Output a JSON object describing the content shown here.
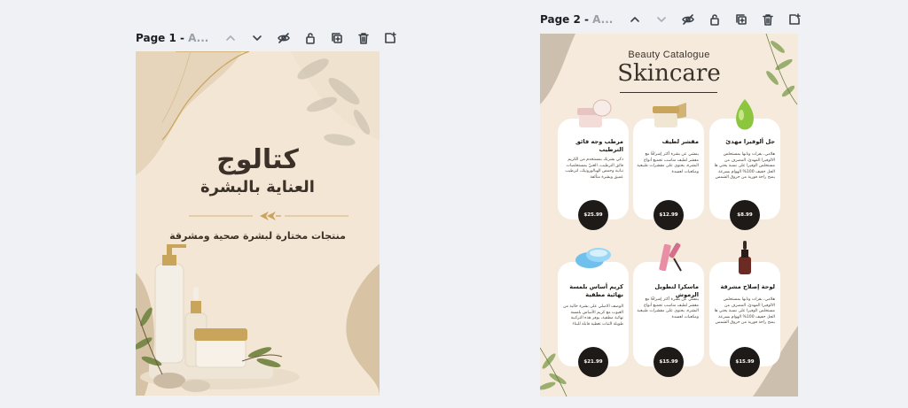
{
  "pages": [
    {
      "title": "Page 1 -",
      "title_suffix": "A..."
    },
    {
      "title": "Page 2 -",
      "title_suffix": "A..."
    }
  ],
  "toolbar_icons": [
    "chevron-up-icon",
    "chevron-down-icon",
    "eye-icon",
    "lock-icon",
    "duplicate-icon",
    "trash-icon",
    "add-page-icon"
  ],
  "page1": {
    "title": "كتالوج",
    "subtitle": "العناية بالبشرة",
    "tagline": "منتجات مختارة لبشرة صحية ومشرقة"
  },
  "page2": {
    "kicker": "Beauty Catalogue",
    "title": "Skincare",
    "products": [
      {
        "name": "جل ألوفيرا مهدئ",
        "desc": "هلامي، بقرات ونابها بمستخلص الالوفيرا المهدئ، المصرف من مستخلص الوفيرا على نسبة يحتي ها الجل خفيف 100% الهوام بسرعة يمنح راحة فورية من حروق الشمس",
        "price": "$8.99",
        "product_icon": "aloe-gel-icon"
      },
      {
        "name": "مقشر لطيف",
        "desc": "يمشي عن بشرة أكثر إشراقًا مع مقشر لطيف مناسب تجميع أنواع البشرة، يحتوي على مقشرات طبيعية ومكعبات لعسدة",
        "price": "$12.99",
        "product_icon": "scrub-jar-icon"
      },
      {
        "name": "مرطب وجه فائق الترطيب",
        "desc": "ذكي بشرتك بمستخدم من الكريم فائق الترطيب، الغنيّ بمستخلصات نباتية وحمض الهيالورونيك، لترطيب عميق وبشرة متألقة",
        "price": "$25.99",
        "product_icon": "cream-jar-icon"
      },
      {
        "name": "لوحة إصلاح مشرقة",
        "desc": "هلامي، بقرات ونابها بمستخلص الالوفيرا المهدئ، المصرف من مستخلص الوفيرا على نسبة يحتي ها الجل خفيف 100% الهوام بسرعة يمنح راحة فورية من حروق الشمس",
        "price": "$15.99",
        "product_icon": "serum-dropper-icon"
      },
      {
        "name": "ماسكرا لتطويل الرموش",
        "desc": "يمشي عن بشرة أكثر إشراقًا مع مقشر لطيف مناسب تجميع أنواع البشرة، يحتوي على مقشرات طبيعية ومكعبات لعسدة",
        "price": "$15.99",
        "product_icon": "mascara-icon"
      },
      {
        "name": "كريم أساس بلمسة نهائية مطفية",
        "desc": "الوصف الاصلي على بشرة خالية من العيوب مع كريم الأساس بلمسة نهائية مطفية، يوفر هذه التركيبة طويلة الثبات تغطية قابلة للبناء",
        "price": "$21.99",
        "product_icon": "foundation-compact-icon"
      }
    ]
  },
  "colors": {
    "workspace": "#f0f1f5",
    "page1_bg": "#f3e6d4",
    "page2_bg": "#f5eadb",
    "gold": "#c9a55c",
    "price_badge": "#1e1a17"
  }
}
